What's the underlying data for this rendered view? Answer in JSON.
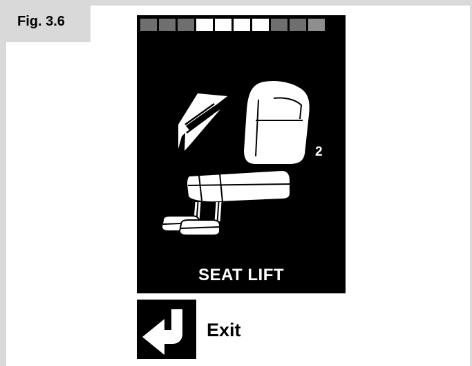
{
  "figure": {
    "label": "Fig. 3.6"
  },
  "display": {
    "level_bar": {
      "segments": 10,
      "highlighted": [
        4,
        5,
        6,
        7
      ]
    },
    "seat_number": "2",
    "title": "SEAT LIFT",
    "icons": [
      "level-bar",
      "up-down-arrow-icon",
      "seat-icon"
    ]
  },
  "exit": {
    "label": "Exit",
    "icon": "return-arrow-icon"
  }
}
